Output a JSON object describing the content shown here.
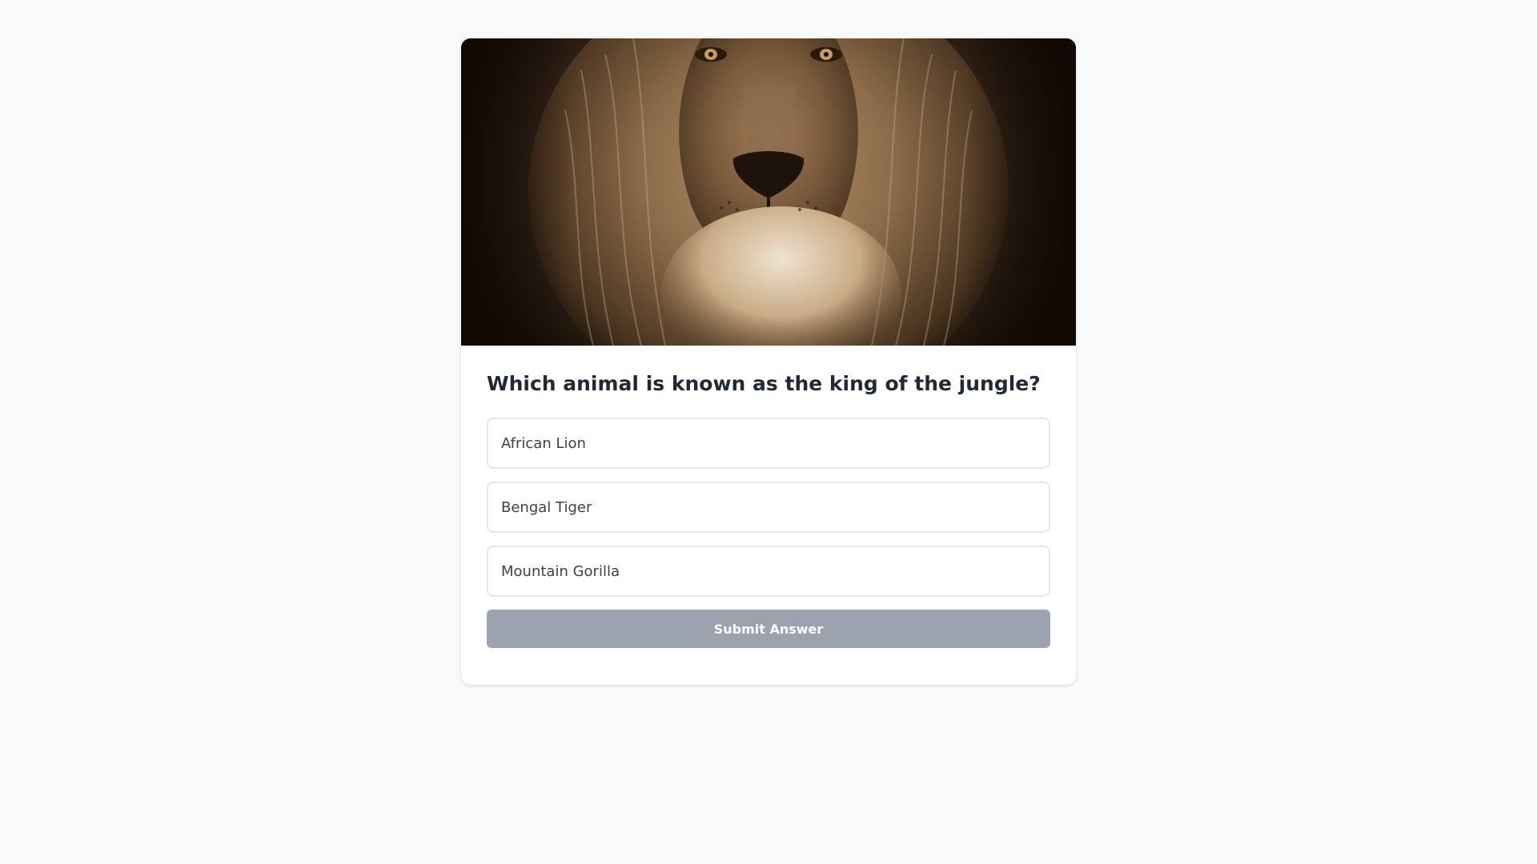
{
  "colors": {
    "page_background": "#f8f9fb",
    "card_background": "#ffffff",
    "question_text": "#1f2937",
    "option_border": "#e5e7eb",
    "option_text": "#374151",
    "submit_disabled": "#9ca3af"
  },
  "quiz": {
    "image": {
      "subject": "lion-face-photo",
      "tone": "sepia"
    },
    "question": "Which animal is known as the king of the jungle?",
    "options": [
      {
        "label": "African Lion"
      },
      {
        "label": "Bengal Tiger"
      },
      {
        "label": "Mountain Gorilla"
      }
    ],
    "submit_label": "Submit Answer",
    "submit_enabled": false
  }
}
